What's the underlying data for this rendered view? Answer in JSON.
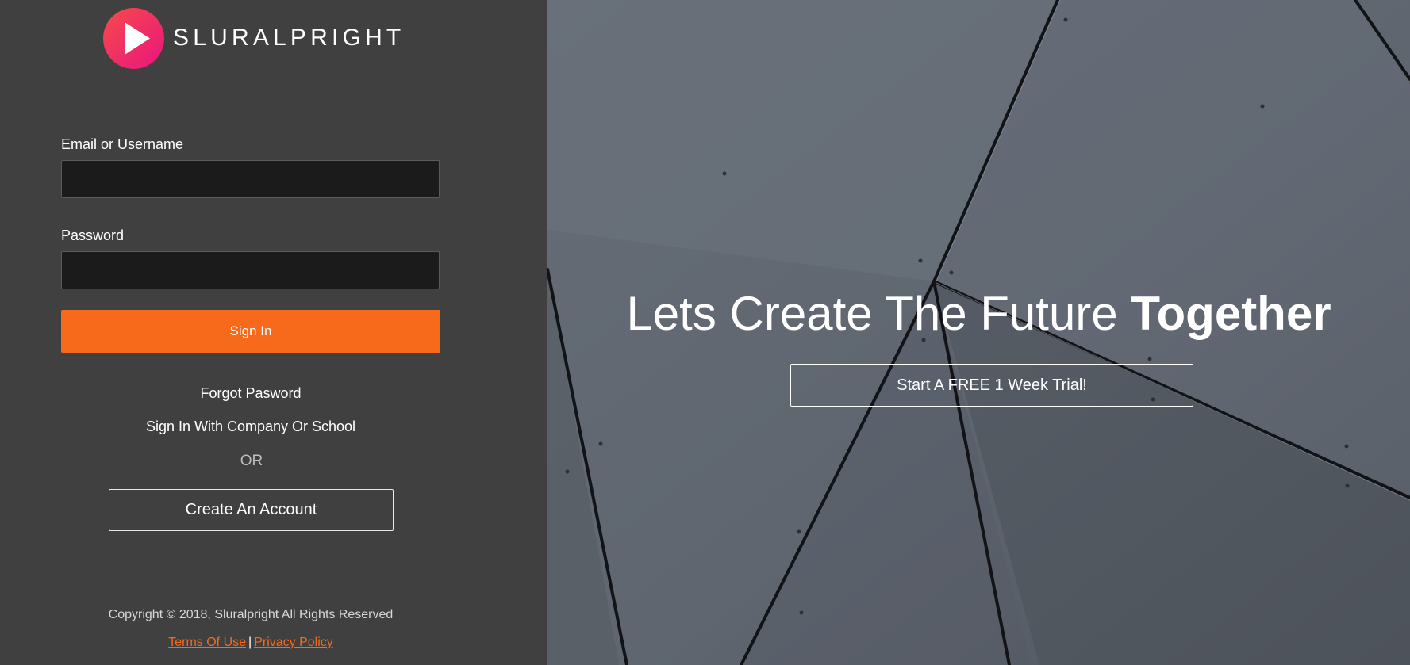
{
  "brand": {
    "name": "SLURALPRIGHT"
  },
  "login_form": {
    "email_label": "Email or Username",
    "email_value": "",
    "password_label": "Password",
    "password_value": "",
    "signin_label": "Sign In",
    "forgot_label": "Forgot Pasword",
    "company_signin_label": "Sign In With Company Or School",
    "or_label": "OR",
    "create_account_label": "Create An Account"
  },
  "footer": {
    "copyright": "Copyright © 2018, Sluralpright All Rights Reserved",
    "terms_label": "Terms Of Use",
    "separator": "|",
    "privacy_label": "Privacy Policy"
  },
  "hero": {
    "title_light": "Lets Create The Future ",
    "title_bold": "Together",
    "trial_button_label": "Start A FREE 1 Week Trial!"
  },
  "colors": {
    "accent": "#f7691b",
    "left_panel_bg": "#404040",
    "input_bg": "#1b1b1b",
    "logo_gradient_start": "#f84a4a",
    "logo_gradient_end": "#e8157f",
    "hero_bg": "#5f6670"
  },
  "icons": {
    "logo": "play-triangle-in-circle"
  }
}
